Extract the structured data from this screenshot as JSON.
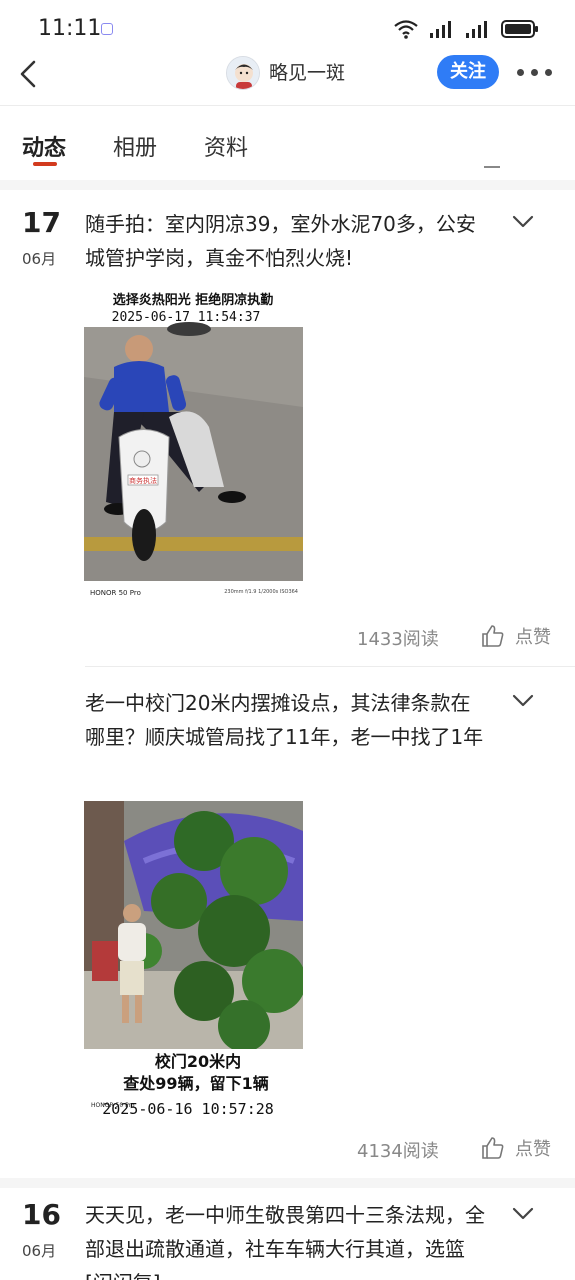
{
  "status_bar": {
    "time": "11:11"
  },
  "nav": {
    "username": "略见一斑",
    "follow_label": "关注"
  },
  "tabs": [
    {
      "label": "动态"
    },
    {
      "label": "相册"
    },
    {
      "label": "资料"
    }
  ],
  "posts": [
    {
      "day": "17",
      "month": "06月",
      "text": "随手拍：室内阴凉39，室外水泥70多，公安城管护学岗，真金不怕烈火烧!",
      "image": {
        "caption_line1": "选择炎热阳光 拒绝阴凉执勤",
        "caption_line2": "2025-06-17 11:54:37",
        "camera": "HONOR 50 Pro",
        "exif": "230mm f/1.9 1/2000s ISO364",
        "scooter_plate": "商务执法"
      },
      "reads": "1433阅读",
      "like_label": "点赞"
    },
    {
      "text": "老一中校门20米内摆摊设点，其法律条款在哪里？顺庆城管局找了11年，老一中找了1年",
      "image": {
        "caption_line1": "校门20米内",
        "caption_line2": "查处99辆，留下1辆",
        "caption_line3": "2025-06-16 10:57:28",
        "camera": "HONOR 50 Pro"
      },
      "reads": "4134阅读",
      "like_label": "点赞"
    },
    {
      "day": "16",
      "month": "06月",
      "text": "天天见，老一中师生敬畏第四十三条法规，全部退出疏散通道，社车车辆大行其道，选篮[闪闪复]"
    }
  ],
  "colors": {
    "accent": "#2f7cf6",
    "tab_indicator": "#d23a1e"
  }
}
